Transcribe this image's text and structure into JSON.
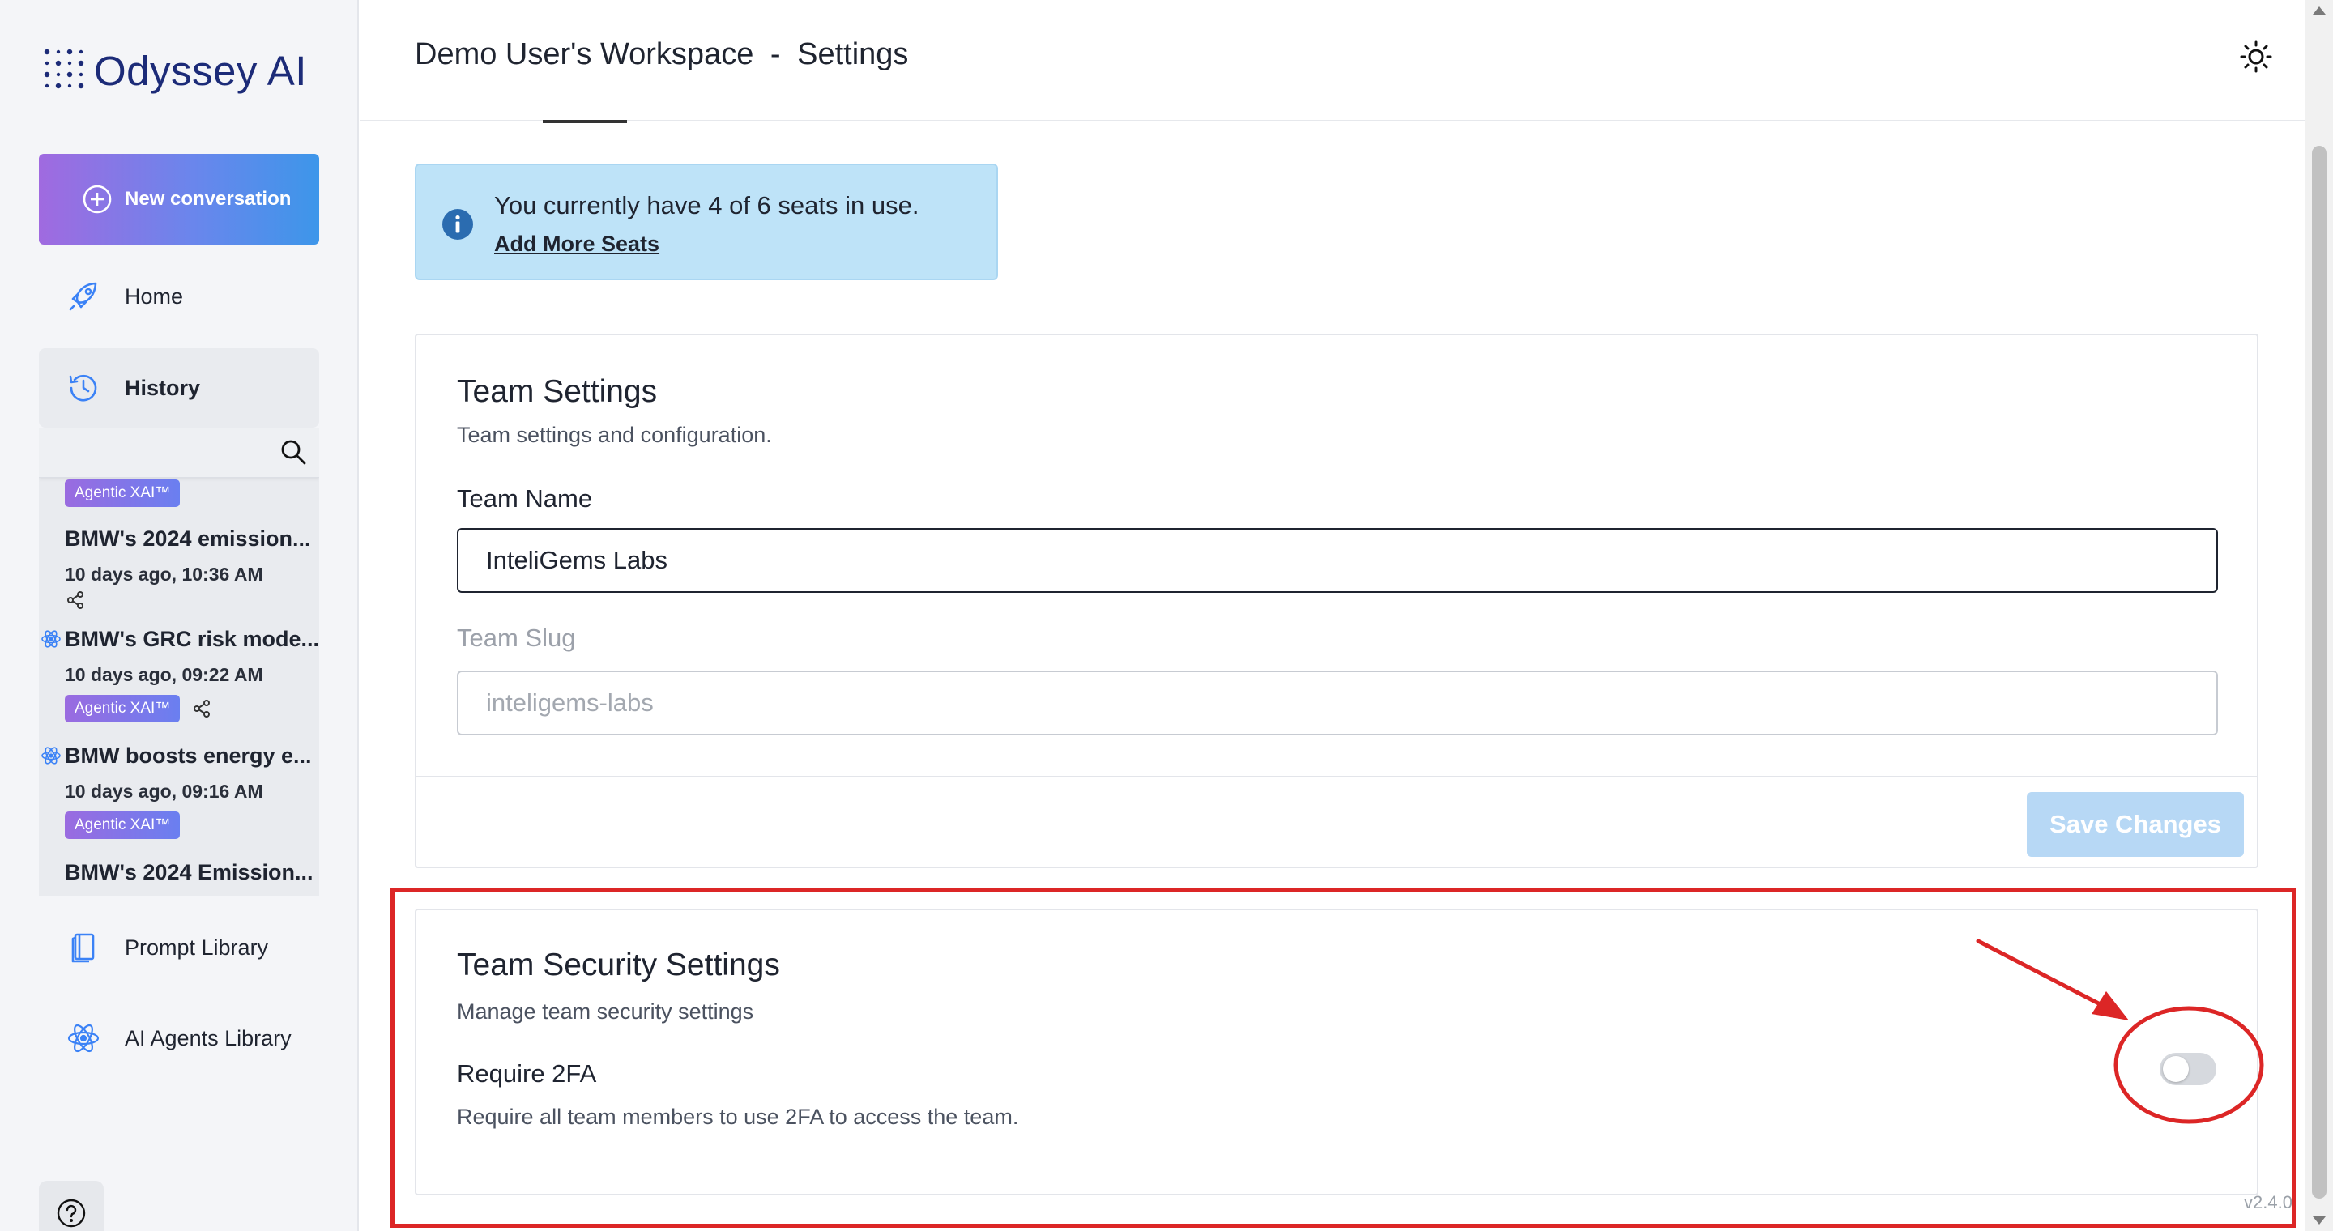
{
  "brand": {
    "name": "Odyssey AI"
  },
  "sidebar": {
    "new_conversation": "New conversation",
    "nav": {
      "home": "Home",
      "history": "History",
      "prompt_library": "Prompt Library",
      "agents_library": "AI Agents Library"
    },
    "history_items": [
      {
        "badge": "Agentic XAI™",
        "title": "BMW's 2024 emission...",
        "time": "10 days ago, 10:36 AM"
      },
      {
        "title": "BMW's GRC risk mode...",
        "time": "10 days ago, 09:22 AM",
        "badge": "Agentic XAI™"
      },
      {
        "title": "BMW boosts energy e...",
        "time": "10 days ago, 09:16 AM",
        "badge": "Agentic XAI™"
      },
      {
        "title": "BMW's 2024 Emission..."
      }
    ]
  },
  "header": {
    "title_workspace": "Demo User's Workspace",
    "title_sep": "-",
    "title_page": "Settings"
  },
  "alert": {
    "message": "You currently have 4 of 6 seats in use.",
    "link": "Add More Seats"
  },
  "team_settings": {
    "title": "Team Settings",
    "subtitle": "Team settings and configuration.",
    "name_label": "Team Name",
    "name_value": "InteliGems Labs",
    "slug_label": "Team Slug",
    "slug_value": "inteligems-labs",
    "save_label": "Save Changes"
  },
  "security_settings": {
    "title": "Team Security Settings",
    "subtitle": "Manage team security settings",
    "require_2fa_label": "Require 2FA",
    "require_2fa_desc": "Require all team members to use 2FA to access the team.",
    "require_2fa_enabled": false
  },
  "version": "v2.4.0",
  "colors": {
    "brand_navy": "#1c2b78",
    "gradient_start": "#a06ae0",
    "gradient_end": "#3d96ea",
    "alert_bg": "#bee3f8",
    "annotation_red": "#dc2626",
    "save_disabled": "#b7d8f5"
  },
  "icons": [
    "dots-logo-icon",
    "plus-circle-icon",
    "rocket-icon",
    "history-icon",
    "search-icon",
    "share-icon",
    "atom-icon",
    "book-icon",
    "agents-icon",
    "help-icon",
    "sun-icon",
    "info-icon"
  ]
}
